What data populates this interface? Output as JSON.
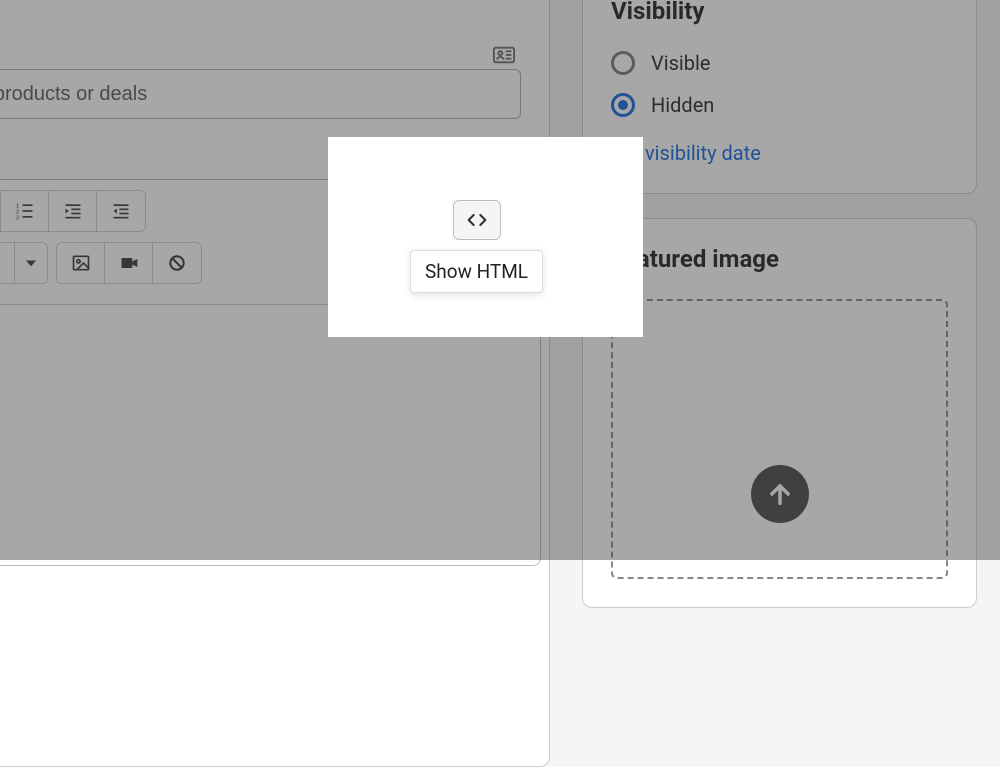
{
  "main": {
    "title_value": "your latest products or deals"
  },
  "editor": {
    "show_html_label": "Show HTML"
  },
  "visibility": {
    "heading": "Visibility",
    "options": {
      "visible": "Visible",
      "hidden": "Hidden"
    },
    "selected": "hidden",
    "set_date_label": "Set visibility date"
  },
  "featured_image": {
    "heading": "Featured image"
  }
}
